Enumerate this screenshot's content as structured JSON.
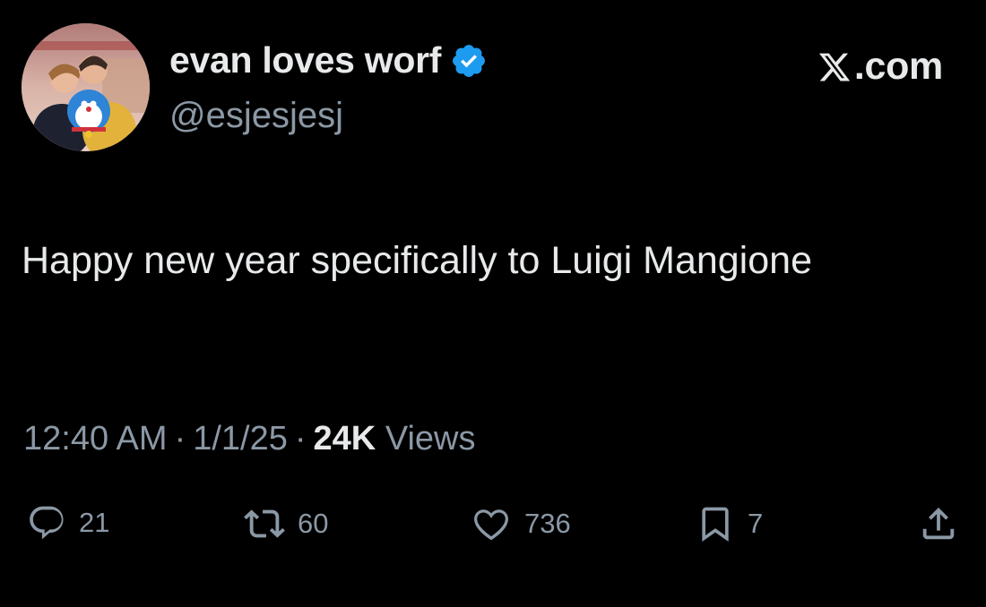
{
  "author": {
    "display_name": "evan loves worf",
    "handle": "@esjesjesj",
    "verified": true,
    "verified_color": "#1d9bf0"
  },
  "brand": {
    "logo_icon": "x-logo-icon",
    "domain": ".com"
  },
  "tweet": {
    "text": "Happy new year specifically to Luigi Mangione"
  },
  "meta": {
    "time": "12:40 AM",
    "separator": "·",
    "date": "1/1/25",
    "views_count": "24K",
    "views_label": "Views"
  },
  "actions": {
    "reply": {
      "icon": "reply-icon",
      "count": "21"
    },
    "repost": {
      "icon": "repost-icon",
      "count": "60"
    },
    "like": {
      "icon": "heart-icon",
      "count": "736"
    },
    "bookmark": {
      "icon": "bookmark-icon",
      "count": "7"
    },
    "share": {
      "icon": "share-icon"
    }
  },
  "colors": {
    "background": "#000000",
    "primary_text": "#e7e9ea",
    "secondary_text": "#8b98a5"
  }
}
